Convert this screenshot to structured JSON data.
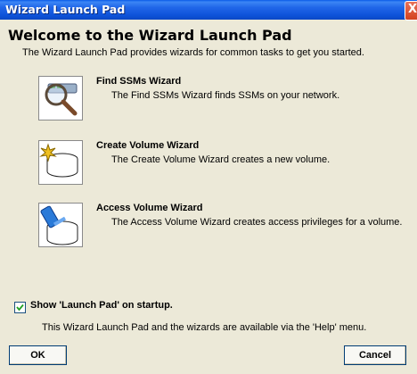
{
  "window": {
    "title": "Wizard Launch Pad",
    "close_glyph": "X"
  },
  "heading": "Welcome to the Wizard Launch Pad",
  "intro": "The Wizard Launch Pad provides wizards for common tasks to get you started.",
  "wizards": [
    {
      "name": "Find SSMs Wizard",
      "description": "The Find SSMs Wizard finds SSMs on your network.",
      "icon": "magnifier-network-icon"
    },
    {
      "name": "Create Volume Wizard",
      "description": "The Create Volume Wizard creates a new volume.",
      "icon": "new-volume-icon"
    },
    {
      "name": "Access Volume Wizard",
      "description": "The Access Volume Wizard creates access privileges for a volume.",
      "icon": "volume-access-icon"
    }
  ],
  "startup": {
    "label": "Show 'Launch Pad' on startup.",
    "checked": true
  },
  "footnote": "This Wizard Launch Pad and the wizards are available via the 'Help' menu.",
  "buttons": {
    "ok": "OK",
    "cancel": "Cancel"
  }
}
